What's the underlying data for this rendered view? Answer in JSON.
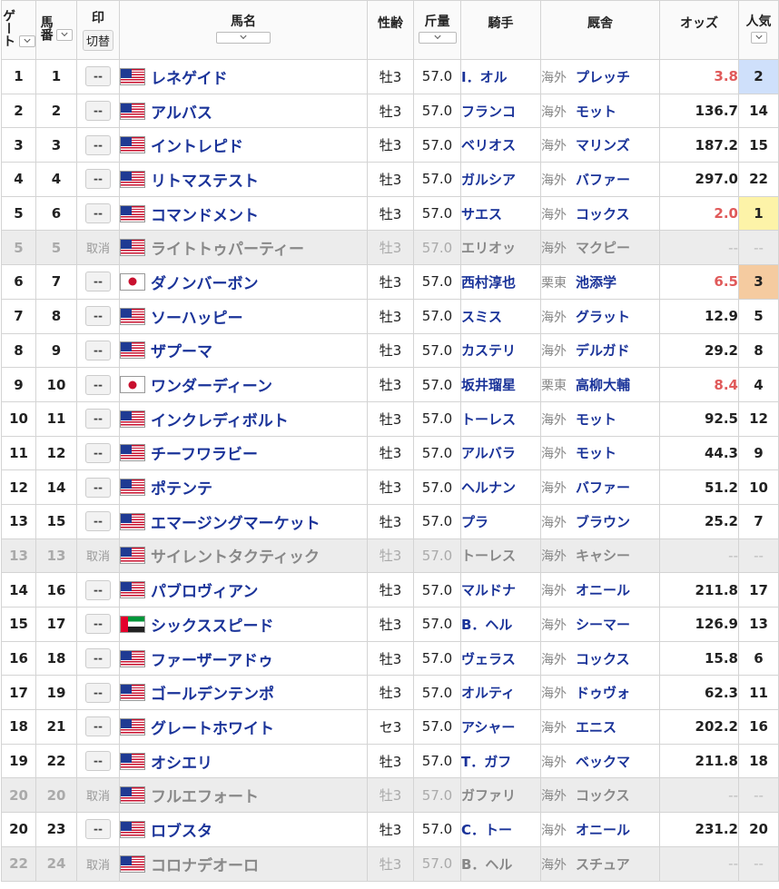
{
  "header": {
    "gate": "ゲート",
    "num": "馬番",
    "mark": "印",
    "mark_toggle": "切替",
    "name": "馬名",
    "sexage": "性齢",
    "weight": "斤量",
    "jockey": "騎手",
    "stable": "厩舎",
    "odds": "オッズ",
    "pop": "人気"
  },
  "mark_empty": "--",
  "scratched_label": "取消",
  "rows": [
    {
      "gate": "1",
      "num": "1",
      "scratched": false,
      "flag": "us-flag",
      "name": "レネゲイド",
      "sexage": "牡3",
      "weight": "57.0",
      "jockey": "I．オル",
      "region": "海外",
      "trainer": "プレッチ",
      "odds": "3.8",
      "pop": "2"
    },
    {
      "gate": "2",
      "num": "2",
      "scratched": false,
      "flag": "us-flag",
      "name": "アルバス",
      "sexage": "牡3",
      "weight": "57.0",
      "jockey": "フランコ",
      "region": "海外",
      "trainer": "モット",
      "odds": "136.7",
      "pop": "14"
    },
    {
      "gate": "3",
      "num": "3",
      "scratched": false,
      "flag": "us-flag",
      "name": "イントレピド",
      "sexage": "牡3",
      "weight": "57.0",
      "jockey": "ベリオス",
      "region": "海外",
      "trainer": "マリンズ",
      "odds": "187.2",
      "pop": "15"
    },
    {
      "gate": "4",
      "num": "4",
      "scratched": false,
      "flag": "us-flag",
      "name": "リトマステスト",
      "sexage": "牡3",
      "weight": "57.0",
      "jockey": "ガルシア",
      "region": "海外",
      "trainer": "バファー",
      "odds": "297.0",
      "pop": "22"
    },
    {
      "gate": "5",
      "num": "6",
      "scratched": false,
      "flag": "us-flag",
      "name": "コマンドメント",
      "sexage": "牡3",
      "weight": "57.0",
      "jockey": "サエス",
      "region": "海外",
      "trainer": "コックス",
      "odds": "2.0",
      "pop": "1"
    },
    {
      "gate": "5",
      "num": "5",
      "scratched": true,
      "flag": "us-flag",
      "name": "ライトトゥパーティー",
      "sexage": "牡3",
      "weight": "57.0",
      "jockey": "エリオッ",
      "region": "海外",
      "trainer": "マクピー",
      "odds": "--",
      "pop": "--"
    },
    {
      "gate": "6",
      "num": "7",
      "scratched": false,
      "flag": "jp-flag",
      "name": "ダノンバーボン",
      "sexage": "牡3",
      "weight": "57.0",
      "jockey": "西村淳也",
      "region": "栗東",
      "trainer": "池添学",
      "odds": "6.5",
      "pop": "3"
    },
    {
      "gate": "7",
      "num": "8",
      "scratched": false,
      "flag": "us-flag",
      "name": "ソーハッピー",
      "sexage": "牡3",
      "weight": "57.0",
      "jockey": "スミス",
      "region": "海外",
      "trainer": "グラット",
      "odds": "12.9",
      "pop": "5"
    },
    {
      "gate": "8",
      "num": "9",
      "scratched": false,
      "flag": "us-flag",
      "name": "ザプーマ",
      "sexage": "牡3",
      "weight": "57.0",
      "jockey": "カステリ",
      "region": "海外",
      "trainer": "デルガド",
      "odds": "29.2",
      "pop": "8"
    },
    {
      "gate": "9",
      "num": "10",
      "scratched": false,
      "flag": "jp-flag",
      "name": "ワンダーディーン",
      "sexage": "牡3",
      "weight": "57.0",
      "jockey": "坂井瑠星",
      "region": "栗東",
      "trainer": "高柳大輔",
      "odds": "8.4",
      "pop": "4"
    },
    {
      "gate": "10",
      "num": "11",
      "scratched": false,
      "flag": "us-flag",
      "name": "インクレディボルト",
      "sexage": "牡3",
      "weight": "57.0",
      "jockey": "トーレス",
      "region": "海外",
      "trainer": "モット",
      "odds": "92.5",
      "pop": "12"
    },
    {
      "gate": "11",
      "num": "12",
      "scratched": false,
      "flag": "us-flag",
      "name": "チーフワラビー",
      "sexage": "牡3",
      "weight": "57.0",
      "jockey": "アルバラ",
      "region": "海外",
      "trainer": "モット",
      "odds": "44.3",
      "pop": "9"
    },
    {
      "gate": "12",
      "num": "14",
      "scratched": false,
      "flag": "us-flag",
      "name": "ポテンテ",
      "sexage": "牡3",
      "weight": "57.0",
      "jockey": "ヘルナン",
      "region": "海外",
      "trainer": "バファー",
      "odds": "51.2",
      "pop": "10"
    },
    {
      "gate": "13",
      "num": "15",
      "scratched": false,
      "flag": "us-flag",
      "name": "エマージングマーケット",
      "sexage": "牡3",
      "weight": "57.0",
      "jockey": "プラ",
      "region": "海外",
      "trainer": "ブラウン",
      "odds": "25.2",
      "pop": "7"
    },
    {
      "gate": "13",
      "num": "13",
      "scratched": true,
      "flag": "us-flag",
      "name": "サイレントタクティック",
      "sexage": "牡3",
      "weight": "57.0",
      "jockey": "トーレス",
      "region": "海外",
      "trainer": "キャシー",
      "odds": "--",
      "pop": "--"
    },
    {
      "gate": "14",
      "num": "16",
      "scratched": false,
      "flag": "us-flag",
      "name": "パブロヴィアン",
      "sexage": "牡3",
      "weight": "57.0",
      "jockey": "マルドナ",
      "region": "海外",
      "trainer": "オニール",
      "odds": "211.8",
      "pop": "17"
    },
    {
      "gate": "15",
      "num": "17",
      "scratched": false,
      "flag": "uae-flag",
      "name": "シックススピード",
      "sexage": "牡3",
      "weight": "57.0",
      "jockey": "B．ヘル",
      "region": "海外",
      "trainer": "シーマー",
      "odds": "126.9",
      "pop": "13"
    },
    {
      "gate": "16",
      "num": "18",
      "scratched": false,
      "flag": "us-flag",
      "name": "ファーザーアドゥ",
      "sexage": "牡3",
      "weight": "57.0",
      "jockey": "ヴェラス",
      "region": "海外",
      "trainer": "コックス",
      "odds": "15.8",
      "pop": "6"
    },
    {
      "gate": "17",
      "num": "19",
      "scratched": false,
      "flag": "us-flag",
      "name": "ゴールデンテンポ",
      "sexage": "牡3",
      "weight": "57.0",
      "jockey": "オルティ",
      "region": "海外",
      "trainer": "ドゥヴォ",
      "odds": "62.3",
      "pop": "11"
    },
    {
      "gate": "18",
      "num": "21",
      "scratched": false,
      "flag": "us-flag",
      "name": "グレートホワイト",
      "sexage": "セ3",
      "weight": "57.0",
      "jockey": "アシャー",
      "region": "海外",
      "trainer": "エニス",
      "odds": "202.2",
      "pop": "16"
    },
    {
      "gate": "19",
      "num": "22",
      "scratched": false,
      "flag": "us-flag",
      "name": "オシエリ",
      "sexage": "牡3",
      "weight": "57.0",
      "jockey": "T．ガフ",
      "region": "海外",
      "trainer": "ベックマ",
      "odds": "211.8",
      "pop": "18"
    },
    {
      "gate": "20",
      "num": "20",
      "scratched": true,
      "flag": "us-flag",
      "name": "フルエフォート",
      "sexage": "牡3",
      "weight": "57.0",
      "jockey": "ガファリ",
      "region": "海外",
      "trainer": "コックス",
      "odds": "--",
      "pop": "--"
    },
    {
      "gate": "20",
      "num": "23",
      "scratched": false,
      "flag": "us-flag",
      "name": "ロブスタ",
      "sexage": "牡3",
      "weight": "57.0",
      "jockey": "C．トー",
      "region": "海外",
      "trainer": "オニール",
      "odds": "231.2",
      "pop": "20"
    },
    {
      "gate": "22",
      "num": "24",
      "scratched": true,
      "flag": "us-flag",
      "name": "コロナデオーロ",
      "sexage": "牡3",
      "weight": "57.0",
      "jockey": "B．ヘル",
      "region": "海外",
      "trainer": "スチュア",
      "odds": "--",
      "pop": "--"
    }
  ],
  "colors": {
    "horse_link": "#1a3399",
    "odds_hot": "#e05a5a",
    "pop1_bg": "#fdf3a8",
    "pop2_bg": "#cfe0fb",
    "pop3_bg": "#f5cba0",
    "scratched_bg": "#ececec"
  }
}
